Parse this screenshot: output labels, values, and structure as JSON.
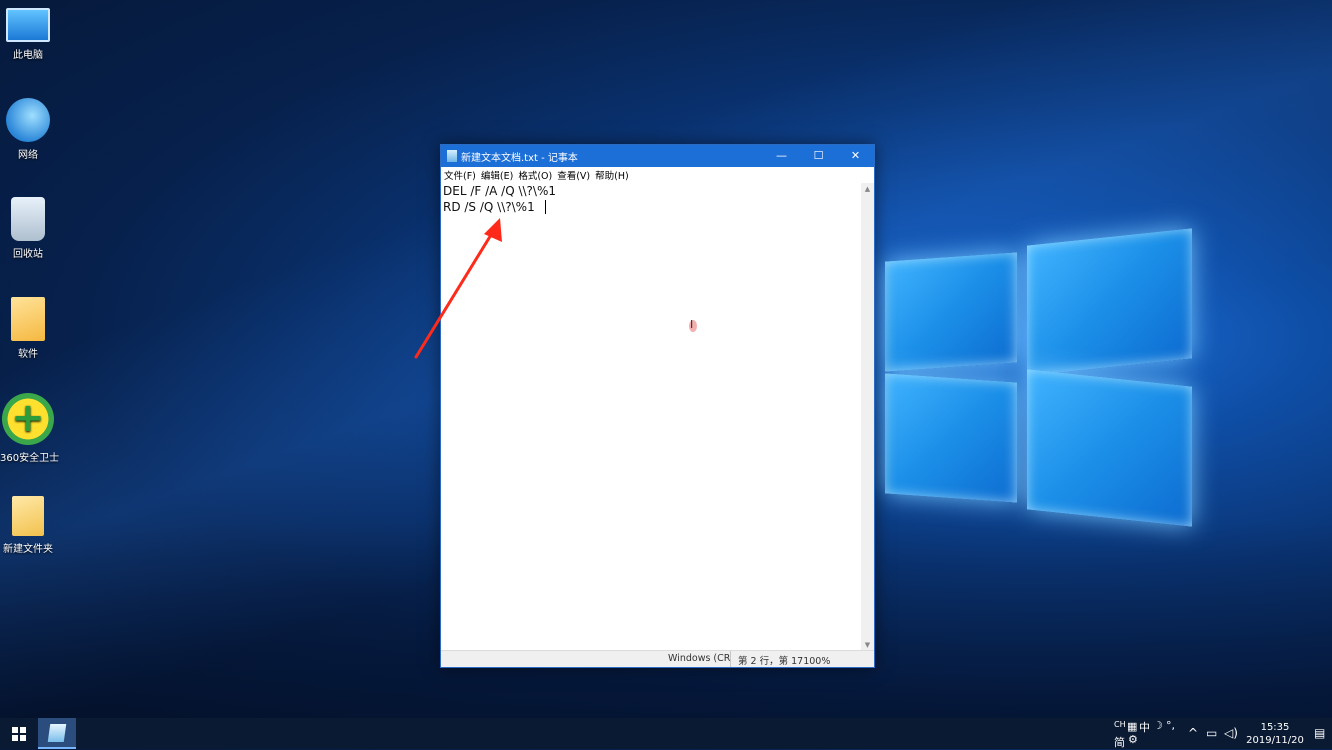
{
  "desktop": {
    "icons": [
      {
        "label": "此电脑"
      },
      {
        "label": "网络"
      },
      {
        "label": "回收站"
      },
      {
        "label": "软件"
      },
      {
        "label": "360安全卫士"
      },
      {
        "label": "新建文件夹"
      }
    ]
  },
  "notepad": {
    "title": "新建文本文档.txt - 记事本",
    "controls": {
      "minimize": "—",
      "maximize": "☐",
      "close": "✕"
    },
    "menu": [
      "文件(F)",
      "编辑(E)",
      "格式(O)",
      "查看(V)",
      "帮助(H)"
    ],
    "lines": [
      "DEL /F /A /Q \\\\?\\%1",
      "RD /S /Q \\\\?\\%1"
    ],
    "status": {
      "encoding": "Windows (CR",
      "position": "第 2 行，第 17100%"
    }
  },
  "taskbar": {
    "tray": {
      "ime_top": "CH",
      "ime_grid": "▦",
      "ime_zh": "中",
      "ime_moon": "☽",
      "ime_dot": "°,",
      "ime_jian": "简",
      "ime_gear": "⚙",
      "chevron": "^",
      "time": "15:35",
      "date": "2019/11/20"
    }
  },
  "colors": {
    "titlebar": "#1d6fd8",
    "arrow": "#ff2a1a",
    "taskbar": "#0b1a33"
  }
}
